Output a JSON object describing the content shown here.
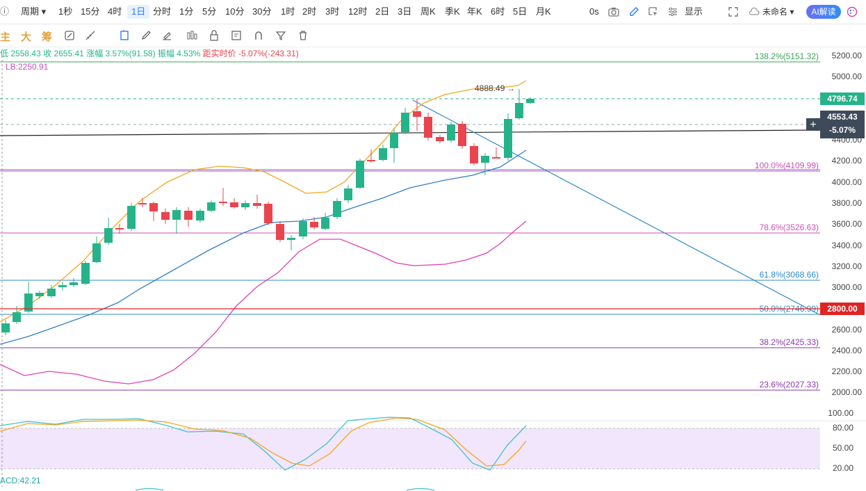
{
  "topbar": {
    "left_glyph": "ⓘ",
    "period_label": "周期",
    "timeframes": [
      "1秒",
      "15分",
      "4时",
      "1日",
      "分时",
      "1分",
      "5分",
      "10分",
      "30分",
      "1时",
      "2时",
      "3时",
      "12时",
      "2日",
      "3日",
      "周K",
      "季K",
      "年K",
      "6时",
      "5日",
      "月K"
    ],
    "active_timeframe": "1日",
    "countdown": "0s",
    "display_label": "显示",
    "layout_name": "未命名",
    "ai_button": "AI解读"
  },
  "toolbar2": {
    "brand_chars": [
      "主",
      "大",
      "筹"
    ],
    "tool_icons": [
      "screenshot-icon",
      "ruler-icon",
      "eraser-icon",
      "rect-select-icon",
      "pen-icon",
      "highlighter-icon",
      "bars-icon",
      "lock-icon",
      "note-icon",
      "magnet-icon",
      "filter-icon",
      "trash-icon"
    ]
  },
  "info": {
    "low_label": "低",
    "low_value": "2558.43",
    "close_label": "收",
    "close_value": "2655.41",
    "change_label": "涨幅",
    "change_value": "3.57%(91.58)",
    "amplitude_label": "振幅",
    "amplitude_value": "4.53%",
    "distance_label": "距实时价",
    "distance_value": "-5.07%(-243.31)",
    "lb_label": "LB:2250.91"
  },
  "price_axis": {
    "ticks": [
      "5200.00",
      "5000.00",
      "4800.00",
      "4600.00",
      "4400.00",
      "4200.00",
      "4000.00",
      "3800.00",
      "3600.00",
      "3400.00",
      "3200.00",
      "3000.00",
      "2800.00",
      "2600.00",
      "2400.00",
      "2200.00",
      "2000.00"
    ],
    "current_price": "4796.74",
    "crosshair_price": "4553.43",
    "crosshair_pct": "-5.07%",
    "red_line_price": "2800.00"
  },
  "fib_levels": [
    {
      "label": "138.2%(5151.32)",
      "color": "#3aa655"
    },
    {
      "label": "100.0%(4109.99)",
      "color": "#c94fb8"
    },
    {
      "label": "78.6%(3526.63)",
      "color": "#c94fb8"
    },
    {
      "label": "61.8%(3068.66)",
      "color": "#2f8ac6"
    },
    {
      "label": "50.0%(2746.99)",
      "color": "#2f8ac6"
    },
    {
      "label": "38.2%(2425.33)",
      "color": "#8a3aa6"
    },
    {
      "label": "23.6%(2027.33)",
      "color": "#8a3aa6"
    }
  ],
  "annotation": {
    "high_label": "4888.49"
  },
  "oscillator_axis": {
    "ticks": [
      "100.00",
      "80.00",
      "50.00",
      "20.00"
    ]
  },
  "acd_label": "ACD:42.21",
  "colors": {
    "up": "#26b38a",
    "down": "#e8454e",
    "accent": "#2e7cf6",
    "ma_short": "#f2a623",
    "ma_long": "#2f7fc6",
    "ma_pink": "#e040b6"
  }
}
